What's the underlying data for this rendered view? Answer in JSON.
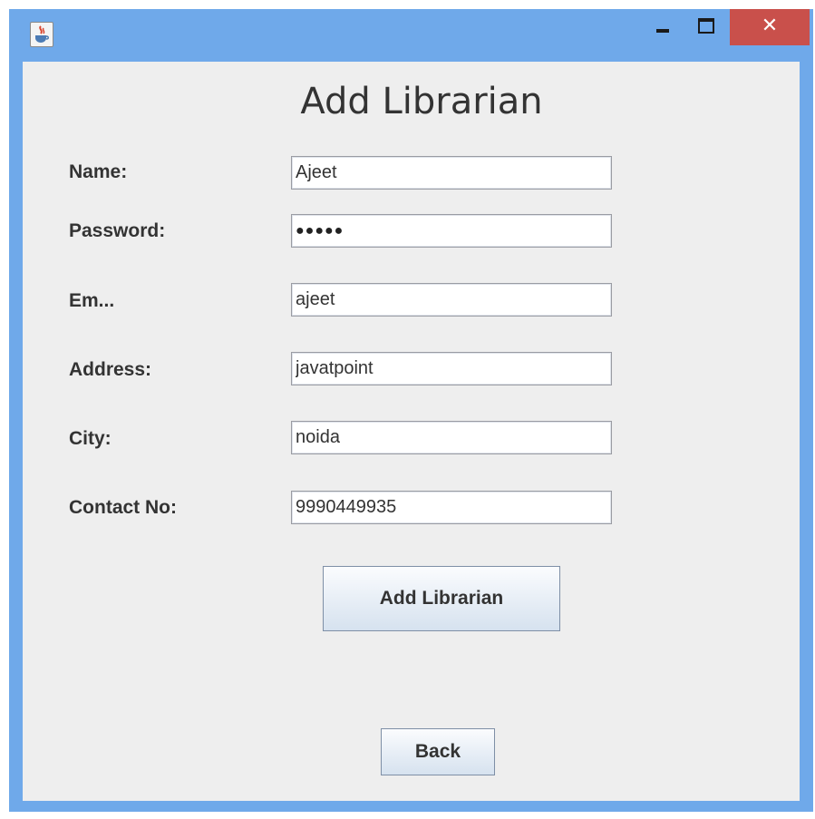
{
  "window": {
    "title": "",
    "controls": {
      "close_glyph": "✕"
    },
    "icons": {
      "app": "java-coffee-icon",
      "minimize": "minimize-icon",
      "maximize": "maximize-icon",
      "close": "close-icon"
    },
    "colors": {
      "titlebar": "#6fa9ea",
      "close": "#c9504b",
      "client": "#eeeeee"
    }
  },
  "form": {
    "heading": "Add Librarian",
    "fields": [
      {
        "label": "Name:",
        "value": "Ajeet"
      },
      {
        "label": "Password:",
        "value": "●●●●●"
      },
      {
        "label": "Em...",
        "value": "ajeet"
      },
      {
        "label": "Address:",
        "value": "javatpoint"
      },
      {
        "label": "City:",
        "value": "noida"
      },
      {
        "label": "Contact No:",
        "value": "9990449935"
      }
    ],
    "submit_label": "Add Librarian",
    "back_label": "Back"
  }
}
